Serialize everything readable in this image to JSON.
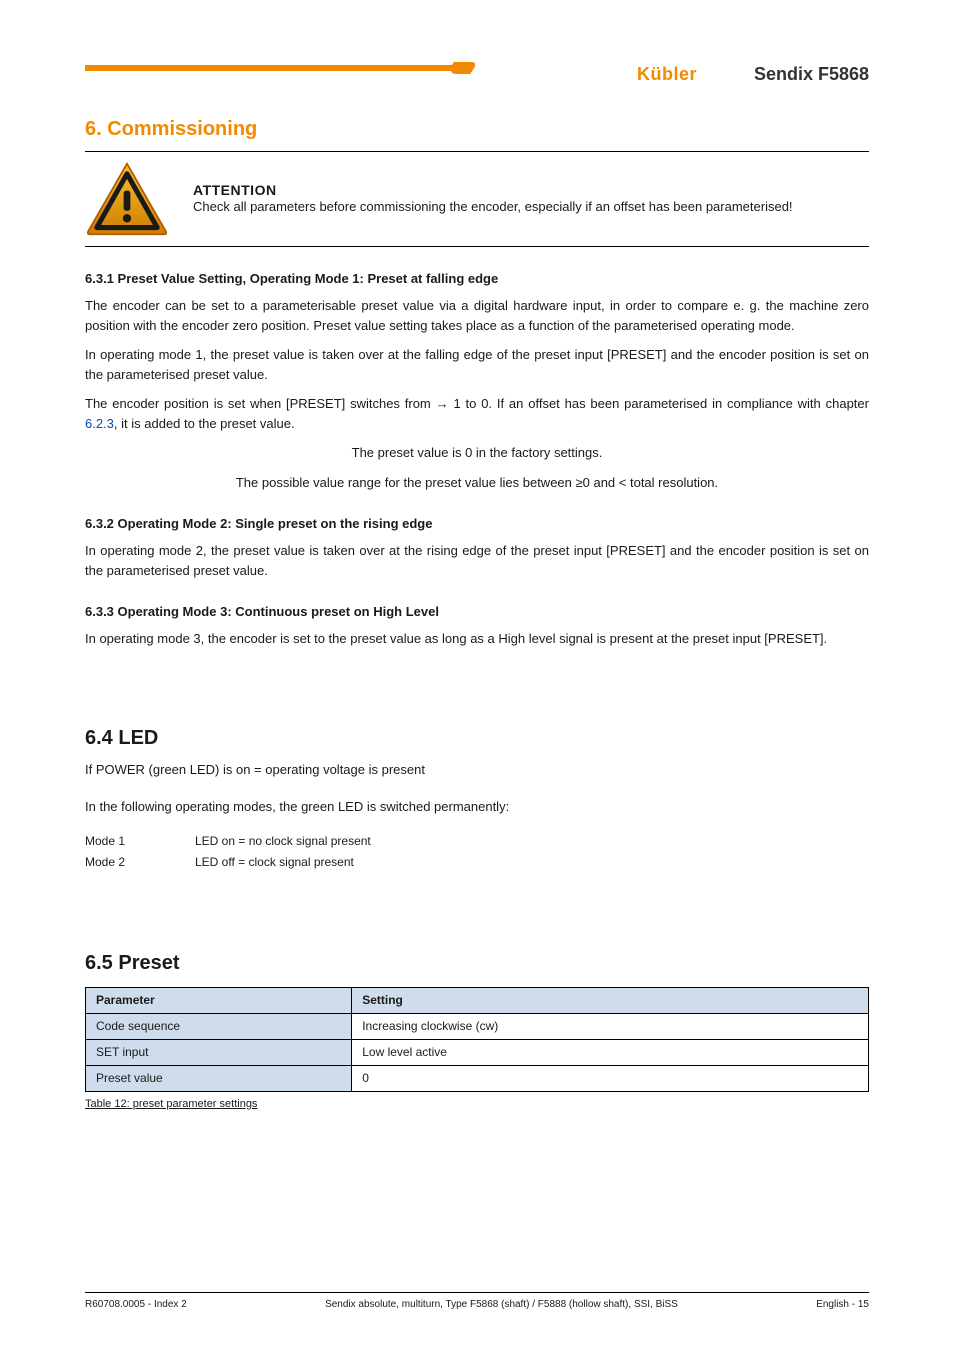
{
  "header": {
    "brand": "Kübler",
    "product": "Sendix F5868"
  },
  "chapter_title": "6. Commissioning",
  "warning": {
    "level": "ATTENTION",
    "text": "Check all parameters before commissioning the encoder, especially if an offset has been parameterised!"
  },
  "s631": {
    "heading": "6.3.1 Preset Value Setting, Operating Mode 1: Preset at falling edge",
    "p1": "The encoder can be set to a parameterisable preset value via a digital hardware input, in order to compare e. g. the machine zero position with the encoder zero position. Preset value setting takes place as a function of the parameterised operating mode.",
    "p2": "In operating mode 1, the preset value is taken over at the falling edge of the preset input [PRESET] and the encoder position is set on the parameterised preset value.",
    "p3_a": "The encoder position is set when [PRESET] switches from",
    "p3_b": " 1 to 0. If an offset has been parameterised in compliance with chapter",
    "p3_link": " 6.2.3",
    "p3_c": ", it is added to the preset value.",
    "p4": "The preset value is 0 in the factory settings.",
    "p5": "The possible value range for the preset value lies between ≥0 and < total resolution."
  },
  "s632": {
    "heading": "6.3.2 Operating Mode 2: Single preset on the rising edge",
    "p1": "In operating mode 2, the preset value is taken over at the rising edge of the preset input [PRESET] and the encoder position is set on the parameterised preset value."
  },
  "s633": {
    "heading": "6.3.3 Operating Mode 3: Continuous preset on High Level",
    "p1": "In operating mode 3, the encoder is set to the preset value as long as a High level signal is present at the preset input [PRESET]."
  },
  "s64": {
    "heading": "6.4 LED",
    "p1": "If POWER (green LED) is on = operating voltage is present",
    "p2": "In the following operating modes, the green LED is switched permanently:",
    "modes": [
      {
        "label": "Mode 1",
        "value": "LED on  = no clock signal present"
      },
      {
        "label": "Mode 2",
        "value": "LED off = clock signal present"
      }
    ]
  },
  "s65": {
    "heading": "6.5 Preset",
    "table": {
      "head": {
        "param": "Parameter",
        "set": "Setting"
      },
      "rows": [
        {
          "param": "Code sequence",
          "set": "Increasing clockwise (cw)"
        },
        {
          "param": "SET input",
          "set": "Low level active"
        },
        {
          "param": "Preset value",
          "set": "0"
        }
      ]
    },
    "caption_label": "Table 12",
    "caption_text": ": preset parameter settings"
  },
  "footer": {
    "left": "R60708.0005 - Index 2",
    "center": "Sendix absolute, multiturn, Type F5868 (shaft) / F5888 (hollow shaft), SSI, BiSS",
    "right": "English - 15"
  }
}
